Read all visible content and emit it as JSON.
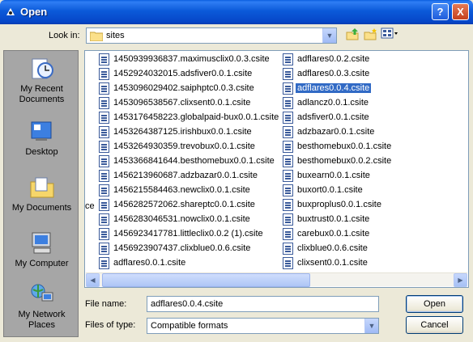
{
  "window": {
    "title": "Open",
    "help_label": "?",
    "close_label": "X"
  },
  "toolbar": {
    "look_in_label": "Look in:",
    "look_in_value": "sites"
  },
  "places": [
    {
      "label": "My Recent Documents",
      "icon": "clock-document-icon"
    },
    {
      "label": "Desktop",
      "icon": "desktop-icon"
    },
    {
      "label": "My Documents",
      "icon": "folder-documents-icon"
    },
    {
      "label": "My Computer",
      "icon": "computer-icon"
    },
    {
      "label": "My Network Places",
      "icon": "network-icon"
    }
  ],
  "files": {
    "column1": [
      "1450939936837.maximusclix0.0.3.csite",
      "1452924032015.adsfiver0.0.1.csite",
      "1453096029402.saiphptc0.0.3.csite",
      "1453096538567.clixsent0.0.1.csite",
      "1453176458223.globalpaid-bux0.0.1.csite",
      "1453264387125.irishbux0.0.1.csite",
      "1453264930359.trevobux0.0.1.csite",
      "1453366841644.besthomebux0.0.1.csite",
      "1456213960687.adzbazar0.0.1.csite",
      "1456215584463.newclix0.0.1.csite",
      "1456282572062.shareptc0.0.1.csite",
      "1456283046531.nowclix0.0.1.csite",
      "1456923417781.littleclix0.0.2 (1).csite",
      "1456923907437.clixblue0.0.6.csite",
      "adflares0.0.1.csite"
    ],
    "column2": [
      "adflares0.0.2.csite",
      "adflares0.0.3.csite",
      "adflares0.0.4.csite",
      "adlancz0.0.1.csite",
      "adsfiver0.0.1.csite",
      "adzbazar0.0.1.csite",
      "besthomebux0.0.1.csite",
      "besthomebux0.0.2.csite",
      "buxearn0.0.1.csite",
      "buxort0.0.1.csite",
      "buxproplus0.0.1.csite",
      "buxtrust0.0.1.csite",
      "carebux0.0.1.csite",
      "clixblue0.0.6.csite",
      "clixsent0.0.1.csite"
    ],
    "selected": "adflares0.0.4.csite",
    "clipped_fragment": "ce"
  },
  "form": {
    "file_name_label": "File name:",
    "file_name_value": "adflares0.0.4.csite",
    "file_type_label": "Files of type:",
    "file_type_value": "Compatible formats"
  },
  "buttons": {
    "open_label": "Open",
    "cancel_label": "Cancel"
  },
  "colors": {
    "title_bar": "#0b5ad9",
    "selection": "#316ac5",
    "dialog_bg": "#ece9d8",
    "places_bg": "#a6a6a6"
  }
}
